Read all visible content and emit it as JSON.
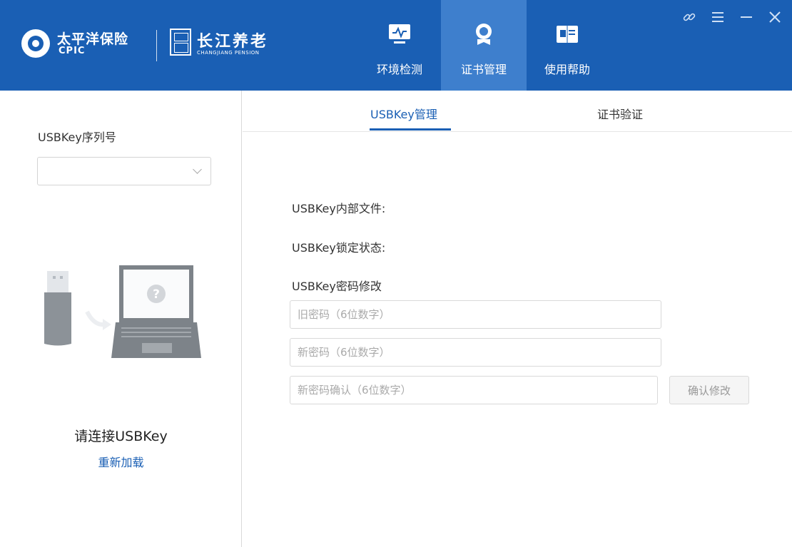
{
  "brand": {
    "cpic_cn": "太平洋保险",
    "cpic_en": "CPIC",
    "changjiang_cn": "长江养老",
    "changjiang_en": "CHANGJIANG PENSION"
  },
  "nav": {
    "tabs": [
      {
        "label": "环境检测",
        "icon": "monitor-icon"
      },
      {
        "label": "证书管理",
        "icon": "certificate-badge-icon",
        "active": true
      },
      {
        "label": "使用帮助",
        "icon": "book-icon"
      }
    ]
  },
  "window_controls": {
    "link": "link-icon",
    "menu": "menu-icon",
    "minimize": "minimize-icon",
    "close": "close-icon"
  },
  "left_panel": {
    "serial_label": "USBKey序列号",
    "serial_value": "",
    "status_text": "请连接USBKey",
    "reload_link": "重新加载"
  },
  "subtabs": [
    {
      "label": "USBKey管理",
      "active": true
    },
    {
      "label": "证书验证",
      "active": false
    }
  ],
  "usbkey": {
    "internal_files_label": "USBKey内部文件:",
    "lock_status_label": "USBKey锁定状态:",
    "password_change_label": "USBKey密码修改",
    "old_password_placeholder": "旧密码（6位数字）",
    "new_password_placeholder": "新密码（6位数字）",
    "confirm_password_placeholder": "新密码确认（6位数字）",
    "confirm_button": "确认修改"
  },
  "colors": {
    "header_bg": "#1a5fb4",
    "active_tab_bg": "#3e7fcd",
    "accent": "#1a5fb4"
  }
}
